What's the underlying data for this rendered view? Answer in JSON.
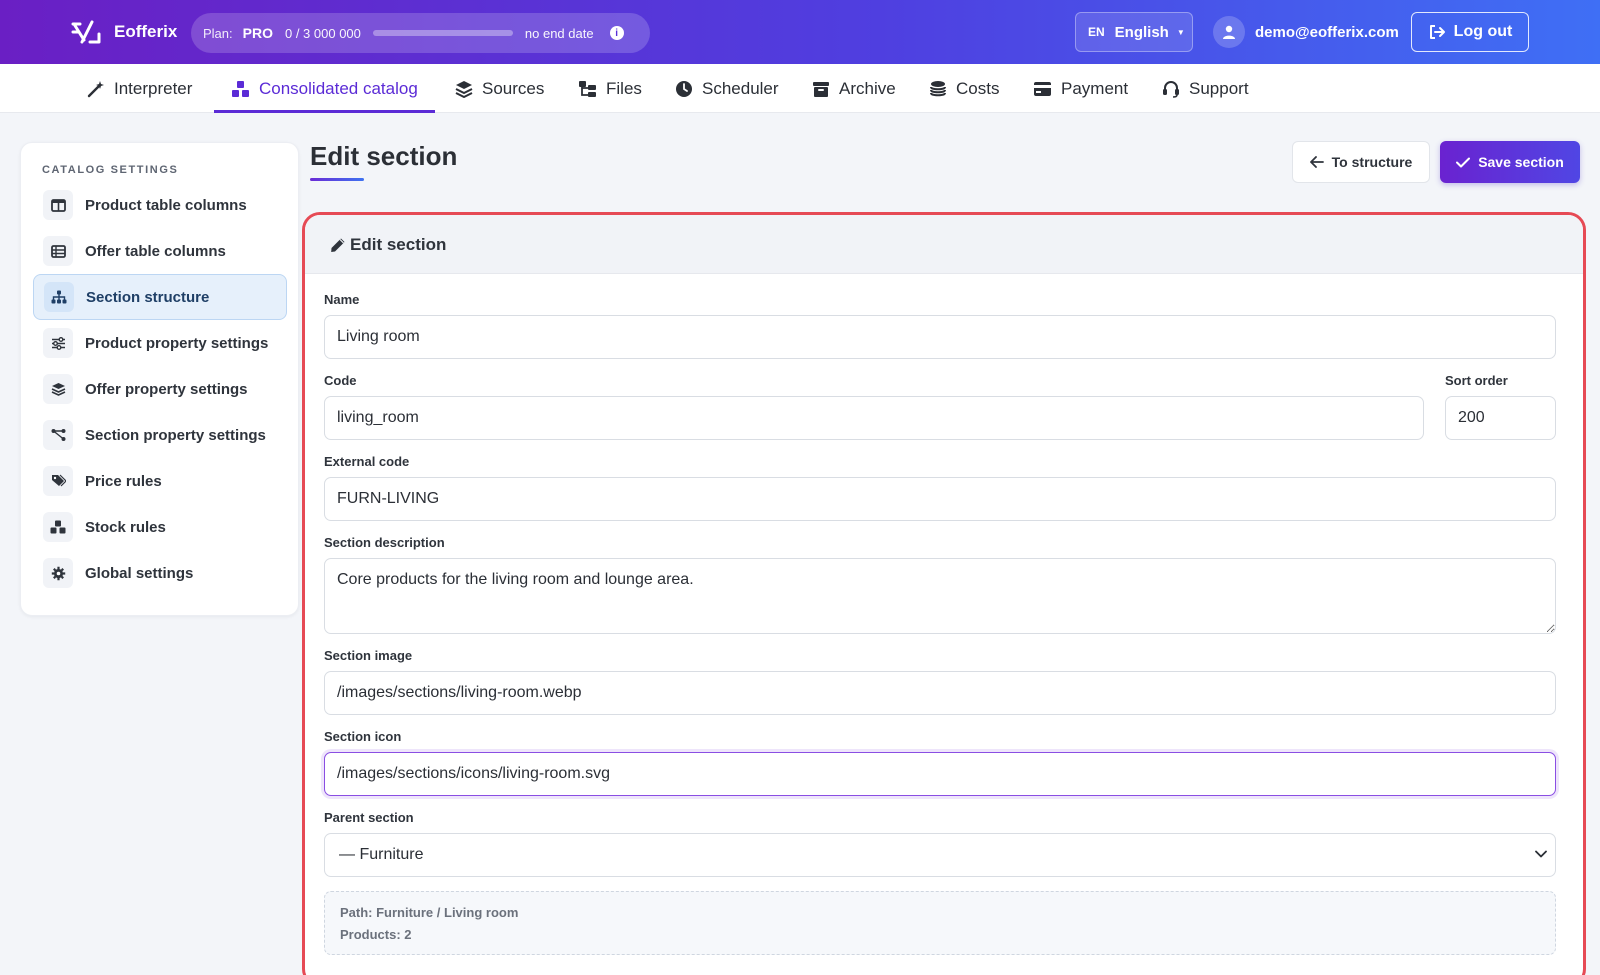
{
  "app": {
    "name": "Eofferix"
  },
  "plan": {
    "label": "Plan:",
    "value": "PRO",
    "usage": "0  /  3 000 000",
    "usage_fraction": 0,
    "end": "no end date"
  },
  "language": {
    "code": "EN",
    "name": "English"
  },
  "user": {
    "email": "demo@eofferix.com"
  },
  "logout_label": "Log out",
  "nav": {
    "items": [
      {
        "label": "Interpreter",
        "icon": "wand-icon"
      },
      {
        "label": "Consolidated catalog",
        "icon": "boxes-icon",
        "active": true
      },
      {
        "label": "Sources",
        "icon": "layers-icon"
      },
      {
        "label": "Files",
        "icon": "folder-tree-icon"
      },
      {
        "label": "Scheduler",
        "icon": "clock-icon"
      },
      {
        "label": "Archive",
        "icon": "archive-box-icon"
      },
      {
        "label": "Costs",
        "icon": "coins-icon"
      },
      {
        "label": "Payment",
        "icon": "credit-card-icon"
      },
      {
        "label": "Support",
        "icon": "headset-icon"
      }
    ]
  },
  "sidebar": {
    "title": "CATALOG SETTINGS",
    "items": [
      {
        "label": "Product table columns",
        "icon": "table-columns-icon"
      },
      {
        "label": "Offer table columns",
        "icon": "table-list-icon"
      },
      {
        "label": "Section structure",
        "icon": "sitemap-icon",
        "active": true
      },
      {
        "label": "Product property settings",
        "icon": "sliders-icon"
      },
      {
        "label": "Offer property settings",
        "icon": "layers-icon"
      },
      {
        "label": "Section property settings",
        "icon": "share-nodes-icon"
      },
      {
        "label": "Price rules",
        "icon": "tags-icon"
      },
      {
        "label": "Stock rules",
        "icon": "cubes-icon"
      },
      {
        "label": "Global settings",
        "icon": "gear-icon"
      }
    ]
  },
  "page": {
    "title": "Edit section",
    "to_structure_label": "To structure",
    "save_label": "Save section"
  },
  "form": {
    "card_title": "Edit section",
    "name": {
      "label": "Name",
      "value": "Living room"
    },
    "code": {
      "label": "Code",
      "value": "living_room"
    },
    "sort": {
      "label": "Sort order",
      "value": "200"
    },
    "external_code": {
      "label": "External code",
      "value": "FURN-LIVING"
    },
    "description": {
      "label": "Section description",
      "value": "Core products for the living room and lounge area."
    },
    "image": {
      "label": "Section image",
      "value": "/images/sections/living-room.webp"
    },
    "icon": {
      "label": "Section icon",
      "value": "/images/sections/icons/living-room.svg"
    },
    "parent": {
      "label": "Parent section",
      "value": "— Furniture"
    },
    "info": {
      "path": "Path: Furniture / Living room",
      "products": "Products: 2"
    }
  },
  "colors": {
    "accent": "#5b2bd6",
    "highlight_border": "#e64a55",
    "active_side_bg": "#e6f0fb"
  }
}
